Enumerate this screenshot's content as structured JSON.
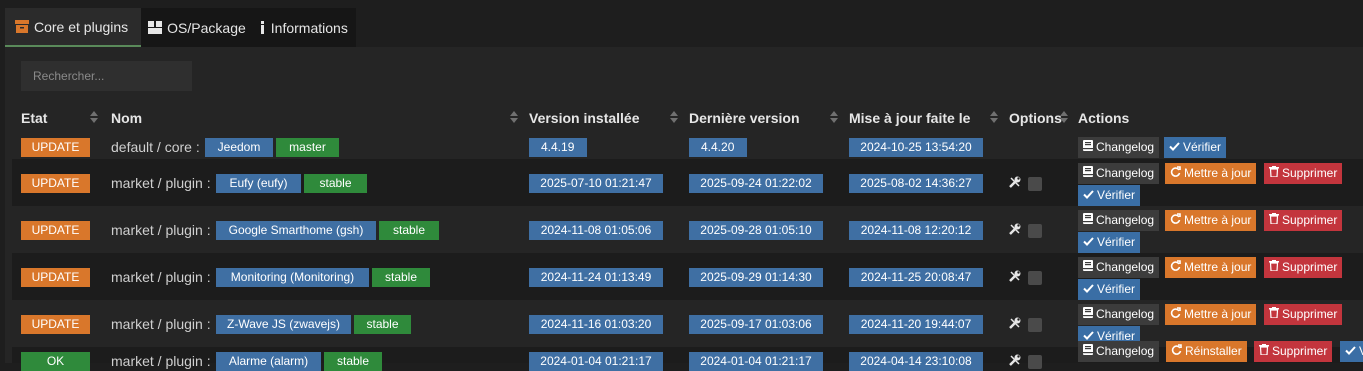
{
  "tabs": [
    {
      "label": "Core et plugins",
      "icon": "archive-icon"
    },
    {
      "label": "OS/Package",
      "icon": "cubes-icon"
    },
    {
      "label": "Informations",
      "icon": "info-icon"
    }
  ],
  "search": {
    "placeholder": "Rechercher..."
  },
  "columns": {
    "etat": "Etat",
    "nom": "Nom",
    "version_installee": "Version installée",
    "derniere_version": "Dernière version",
    "mise_a_jour": "Mise à jour faite le",
    "options": "Options",
    "actions": "Actions"
  },
  "buttons": {
    "changelog": "Changelog",
    "verifier": "Vérifier",
    "mettre_a_jour": "Mettre à jour",
    "supprimer": "Supprimer",
    "reinstaller": "Réinstaller"
  },
  "colors": {
    "update": "#d9772b",
    "ok": "#2f8a3b",
    "name_tag": "#3f6fa3",
    "branch_tag": "#2f8a3b",
    "supprimer": "#c3353d"
  },
  "rows": [
    {
      "etat": "UPDATE",
      "prefix": "default / core :",
      "name": "Jeedom",
      "branch": "master",
      "installed": "4.4.19",
      "latest": "4.4.20",
      "updated": "2024-10-25 13:54:20"
    },
    {
      "etat": "UPDATE",
      "prefix": "market / plugin :",
      "name": "Eufy (eufy)",
      "branch": "stable",
      "installed": "2025-07-10 01:21:47",
      "latest": "2025-09-24 01:22:02",
      "updated": "2025-08-02 14:36:27"
    },
    {
      "etat": "UPDATE",
      "prefix": "market / plugin :",
      "name": "Google Smarthome (gsh)",
      "branch": "stable",
      "installed": "2024-11-08 01:05:06",
      "latest": "2025-09-28 01:05:10",
      "updated": "2024-11-08 12:20:12"
    },
    {
      "etat": "UPDATE",
      "prefix": "market / plugin :",
      "name": "Monitoring (Monitoring)",
      "branch": "stable",
      "installed": "2024-11-24 01:13:49",
      "latest": "2025-09-29 01:14:30",
      "updated": "2024-11-25 20:08:47"
    },
    {
      "etat": "UPDATE",
      "prefix": "market / plugin :",
      "name": "Z-Wave JS (zwavejs)",
      "branch": "stable",
      "installed": "2024-11-16 01:03:20",
      "latest": "2025-09-17 01:03:06",
      "updated": "2024-11-20 19:44:07"
    },
    {
      "etat": "OK",
      "prefix": "market / plugin :",
      "name": "Alarme (alarm)",
      "branch": "stable",
      "installed": "2024-01-04 01:21:17",
      "latest": "2024-01-04 01:21:17",
      "updated": "2024-04-14 23:10:08"
    }
  ]
}
